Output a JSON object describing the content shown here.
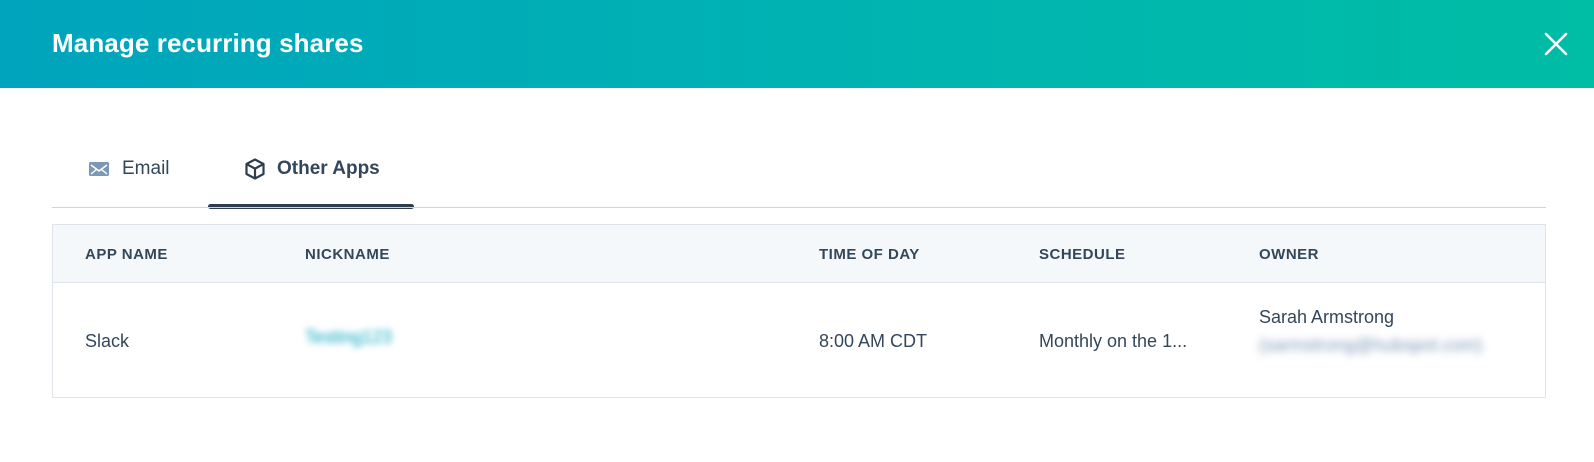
{
  "header": {
    "title": "Manage recurring shares",
    "close_icon": "close-icon",
    "gradient_start": "#00a4bd",
    "gradient_end": "#00bda5"
  },
  "tabs": [
    {
      "label": "Email",
      "icon": "envelope-icon",
      "active": false
    },
    {
      "label": "Other Apps",
      "icon": "cube-icon",
      "active": true
    }
  ],
  "table": {
    "columns": [
      "APP NAME",
      "NICKNAME",
      "TIME OF DAY",
      "SCHEDULE",
      "OWNER"
    ],
    "rows": [
      {
        "app_name": "Slack",
        "nickname": "Testing123",
        "time_of_day": "8:00 AM CDT",
        "schedule": "Monthly on the 1...",
        "owner_name": "Sarah Armstrong",
        "owner_email": "(sarmstrong@hubspot.com)"
      }
    ]
  },
  "colors": {
    "text": "#33475b",
    "link": "#00a4bd",
    "active_tab_underline": "#2d3e50"
  }
}
